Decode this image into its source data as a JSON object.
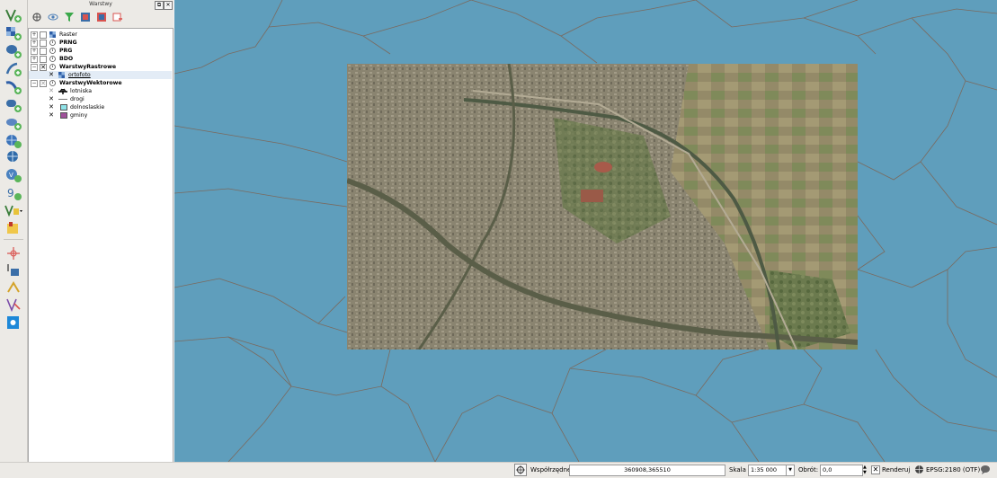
{
  "panel": {
    "title": "Warstwy"
  },
  "layers": {
    "raster": "Raster",
    "prng": "PRNG",
    "prg": "PRG",
    "bdo": "BDO",
    "warstwy_rastrowe": "WarstwyRastrowe",
    "ortofoto": "ortofoto",
    "warstwy_wektorowe": "WarstwyWektorowe",
    "lotniska": "lotniska",
    "drogi": "drogi",
    "dolnoslaskie": "dolnoslaskie",
    "gminy": "gminy"
  },
  "status": {
    "coords_label": "Współrzędne:",
    "coords_value": "360908,365510",
    "scale_label": "Skala",
    "scale_value": "1:35 000",
    "rotation_label": "Obrót:",
    "rotation_value": "0,0",
    "render_label": "Renderuj",
    "crs": "EPSG:2180 (OTF)"
  },
  "colors": {
    "map_background": "#5f9ebc",
    "boundary_lines": "#7a6a5f",
    "dolnoslaskie_swatch": "#8fe3e8",
    "gminy_swatch": "#a0509a"
  }
}
